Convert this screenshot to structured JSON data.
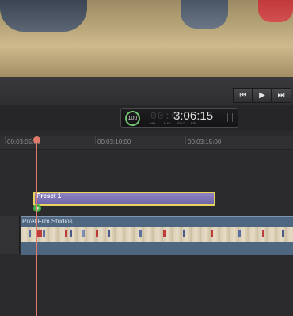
{
  "viewer": {
    "description_icon": "video-frame"
  },
  "transport": {
    "prev_label": "⏮",
    "play_label": "▶",
    "next_label": "⏭"
  },
  "timecode": {
    "zoom_percent": "100",
    "dim_prefix": "00:0",
    "value": "3:06:15",
    "units": [
      "HR",
      "MIN",
      "SEC",
      "FR"
    ]
  },
  "ruler": {
    "ticks": [
      "00:03:05:00",
      "00:03:10:00",
      "00:03:15:00"
    ]
  },
  "clips": {
    "preset_label": "Preset 1",
    "add_badge": "+",
    "main_label": "Pixel Film Studios"
  },
  "colors": {
    "preset_fill": "#7a6fb8",
    "preset_border": "#e8d35a",
    "clip_fill": "#4f6680",
    "playhead": "#e07a6a",
    "add_badge": "#3db041"
  }
}
